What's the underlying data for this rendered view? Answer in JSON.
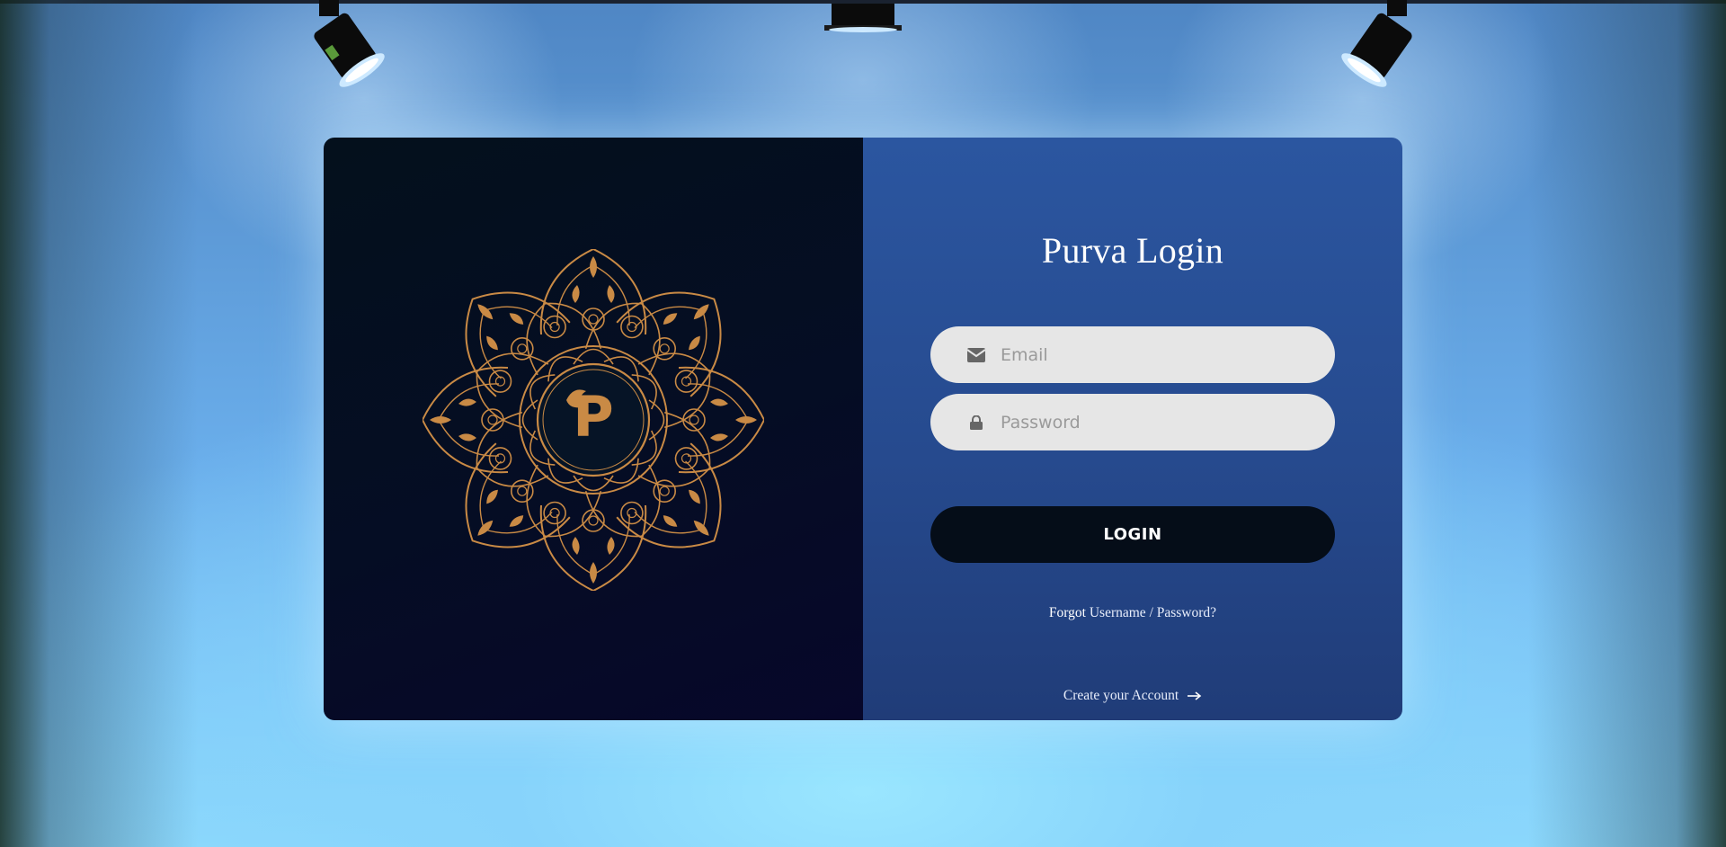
{
  "login": {
    "title": "Purva Login",
    "email_placeholder": "Email",
    "password_placeholder": "Password",
    "submit_label": "LOGIN",
    "forgot_strong": "Forgot",
    "forgot_rest": "Username / Password?",
    "create_account": "Create your Account"
  },
  "logo": {
    "letter": "P"
  },
  "icons": {
    "email": "envelope-icon",
    "password": "lock-icon",
    "create_arrow": "arrow-right-icon"
  },
  "colors": {
    "logo_gold": "#c98a45",
    "button_bg": "#050d18",
    "panel_blue": "#2b56a0",
    "panel_dark": "#04101c"
  }
}
